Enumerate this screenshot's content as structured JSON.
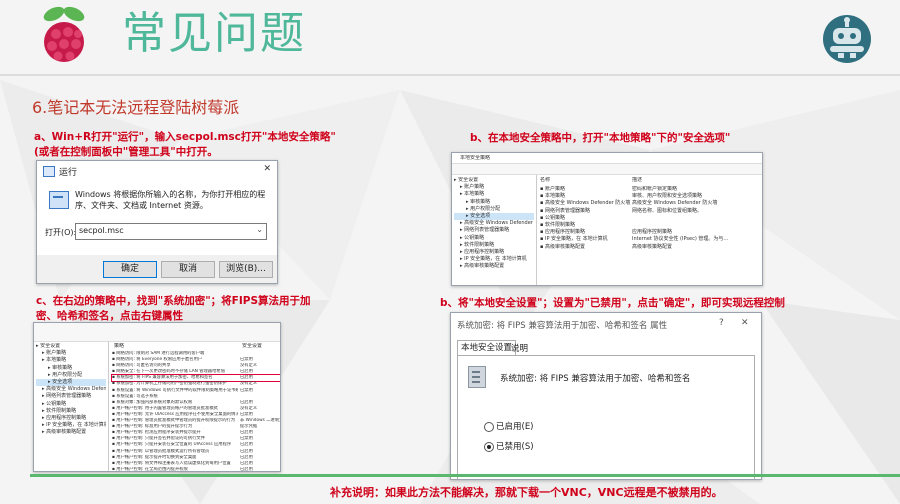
{
  "header": {
    "title": "常见问题"
  },
  "section_title": "6.笔记本无法远程登陆树莓派",
  "captions": {
    "a": "a、Win+R打开\"运行\"，输入secpol.msc打开\"本地安全策略\"\n(或者在控制面板中\"管理工具\"中打开。",
    "b_top": "b、在本地安全策略中，打开\"本地策略\"下的\"安全选项\"",
    "c": "c、在右边的策略中，找到\"系统加密\"；将FIPS算法用于加\n密、哈希和签名，点击右键属性",
    "b_bottom": "b、将\"本地安全设置\"；设置为\"已禁用\"，点击\"确定\"，即可实现远程控制"
  },
  "footer_note": "补充说明：如果此方法不能解决，那就下载一个VNC，VNC远程是不被禁用的。",
  "run_dialog": {
    "title": "运行",
    "close": "✕",
    "desc": "Windows 将根据你所输入的名称，为你打开相应的程序、文件夹、文档或 Internet 资源。",
    "open_label": "打开(O):",
    "open_value": "secpol.msc",
    "ok": "确定",
    "cancel": "取消",
    "browse": "浏览(B)..."
  },
  "secpol_window": {
    "title": "本地安全策略",
    "tree": [
      "安全设置",
      "账户策略",
      "本地策略",
      "审核策略",
      "用户权限分配",
      "安全选项",
      "高级安全 Windows Defender 防火墙",
      "网络列表管理器策略",
      "公钥策略",
      "软件限制策略",
      "应用程序控制策略",
      "IP 安全策略，在 本地计算机",
      "高级审核策略配置"
    ],
    "col_name": "名称",
    "col_desc": "描述",
    "rows": [
      {
        "name": "账户策略",
        "desc": "密码和帐户锁定策略"
      },
      {
        "name": "本地策略",
        "desc": "审核、用户权限和安全选项策略"
      },
      {
        "name": "高级安全 Windows Defender 防火墙",
        "desc": "高级安全 Windows Defender 防火墙"
      },
      {
        "name": "网络列表管理器策略",
        "desc": "网络名称、图标和位置组策略。"
      },
      {
        "name": "公钥策略",
        "desc": ""
      },
      {
        "name": "软件限制策略",
        "desc": ""
      },
      {
        "name": "应用程序控制策略",
        "desc": "应用程序控制策略"
      },
      {
        "name": "IP 安全策略，在 本地计算机",
        "desc": "Internet 协议安全性 (IPsec) 管理。为与..."
      },
      {
        "name": "高级审核策略配置",
        "desc": "高级审核策略配置"
      }
    ]
  },
  "options_window": {
    "col_policy": "策略",
    "col_setting": "安全设置",
    "tree": [
      "安全设置",
      "账户策略",
      "本地策略",
      "审核策略",
      "用户权限分配",
      "安全选项",
      "高级安全 Windows Defender 防火墙",
      "网络列表管理器策略",
      "公钥策略",
      "软件限制策略",
      "应用程序控制策略",
      "IP 安全策略，在 本地计算机",
      "高级审核策略配置"
    ],
    "rows": [
      {
        "name": "网络访问: 限制对 SAM 进行远程调用的客户端",
        "value": ""
      },
      {
        "name": "网络访问: 将 Everyone 权限应用于匿名用户",
        "value": "已禁用"
      },
      {
        "name": "网络访问: 可匿名访问的共享",
        "value": "没有定义"
      },
      {
        "name": "网络安全: 在下一次更改密码时不存储 LAN 管理器哈希值",
        "value": "已启用"
      },
      {
        "name": "系统加密: 将 FIPS 兼容算法用于加密、哈希和签名",
        "value": "已启用"
      },
      {
        "name": "系统加密: 为计算机上存储的用户密钥强制进行强密钥保护",
        "value": "没有定义"
      },
      {
        "name": "系统设置: 将 Windows 可执行文件中的软件限制策略用于证书规则",
        "value": "已禁用"
      },
      {
        "name": "系统设置: 可选子系统",
        "value": ""
      },
      {
        "name": "系统对象: 加强内部系统对象的默认权限",
        "value": "已启用"
      },
      {
        "name": "用户帐户控制: 用于内置管理员帐户的管理员批准模式",
        "value": "没有定义"
      },
      {
        "name": "用户帐户控制: 允许 UIAccess 应用程序在不使用安全桌面的情况下提升权限",
        "value": "已禁用"
      },
      {
        "name": "用户帐户控制: 管理员批准模式中管理员的提升权限提示的行为",
        "value": "非 Windows 二进制文件..."
      },
      {
        "name": "用户帐户控制: 标准用户的提升提示行为",
        "value": "提示凭据"
      },
      {
        "name": "用户帐户控制: 检测应用程序安装并提示提升",
        "value": "已启用"
      },
      {
        "name": "用户帐户控制: 只提升签名并验证的可执行文件",
        "value": "已禁用"
      },
      {
        "name": "用户帐户控制: 只提升安装在安全位置的 UIAccess 应用程序",
        "value": "已启用"
      },
      {
        "name": "用户帐户控制: 以管理员批准模式运行所有管理员",
        "value": "已启用"
      },
      {
        "name": "用户帐户控制: 提示提升时切换到安全桌面",
        "value": "已启用"
      },
      {
        "name": "用户帐户控制: 将文件和注册表写入错误虚拟化到每用户位置",
        "value": "已启用"
      },
      {
        "name": "用户帐户控制: 在全局范围内提升权限",
        "value": "已启用"
      }
    ]
  },
  "props_dialog": {
    "title": "系统加密: 将 FIPS 兼容算法用于加密、哈希和签名 属性",
    "help": "?",
    "close": "✕",
    "tab_local": "本地安全设置",
    "tab_explain": "说明",
    "policy_name": "系统加密: 将 FIPS 兼容算法用于加密、哈希和签名",
    "option_enabled": "已启用(E)",
    "option_disabled": "已禁用(S)",
    "selected": "disabled"
  },
  "colors": {
    "title": "#4fb89a",
    "accent_red": "#d0021b",
    "green": "#59b86d"
  }
}
